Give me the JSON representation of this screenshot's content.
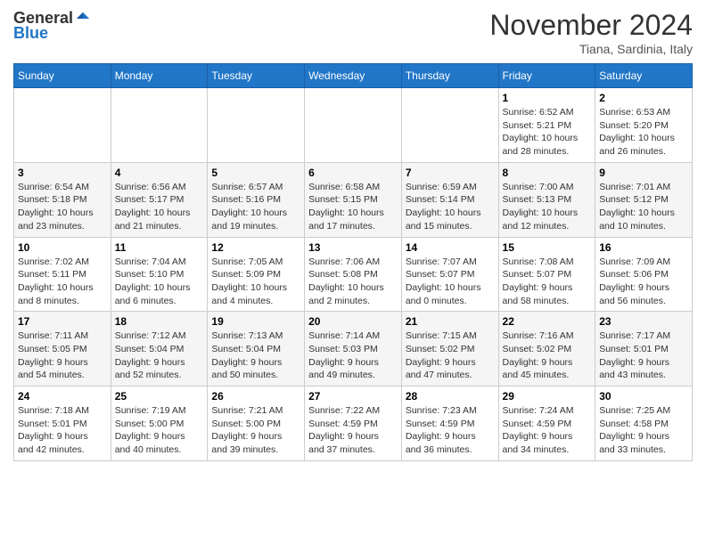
{
  "header": {
    "logo_general": "General",
    "logo_blue": "Blue",
    "month": "November 2024",
    "location": "Tiana, Sardinia, Italy"
  },
  "weekdays": [
    "Sunday",
    "Monday",
    "Tuesday",
    "Wednesday",
    "Thursday",
    "Friday",
    "Saturday"
  ],
  "weeks": [
    [
      {
        "day": "",
        "info": ""
      },
      {
        "day": "",
        "info": ""
      },
      {
        "day": "",
        "info": ""
      },
      {
        "day": "",
        "info": ""
      },
      {
        "day": "",
        "info": ""
      },
      {
        "day": "1",
        "info": "Sunrise: 6:52 AM\nSunset: 5:21 PM\nDaylight: 10 hours\nand 28 minutes."
      },
      {
        "day": "2",
        "info": "Sunrise: 6:53 AM\nSunset: 5:20 PM\nDaylight: 10 hours\nand 26 minutes."
      }
    ],
    [
      {
        "day": "3",
        "info": "Sunrise: 6:54 AM\nSunset: 5:18 PM\nDaylight: 10 hours\nand 23 minutes."
      },
      {
        "day": "4",
        "info": "Sunrise: 6:56 AM\nSunset: 5:17 PM\nDaylight: 10 hours\nand 21 minutes."
      },
      {
        "day": "5",
        "info": "Sunrise: 6:57 AM\nSunset: 5:16 PM\nDaylight: 10 hours\nand 19 minutes."
      },
      {
        "day": "6",
        "info": "Sunrise: 6:58 AM\nSunset: 5:15 PM\nDaylight: 10 hours\nand 17 minutes."
      },
      {
        "day": "7",
        "info": "Sunrise: 6:59 AM\nSunset: 5:14 PM\nDaylight: 10 hours\nand 15 minutes."
      },
      {
        "day": "8",
        "info": "Sunrise: 7:00 AM\nSunset: 5:13 PM\nDaylight: 10 hours\nand 12 minutes."
      },
      {
        "day": "9",
        "info": "Sunrise: 7:01 AM\nSunset: 5:12 PM\nDaylight: 10 hours\nand 10 minutes."
      }
    ],
    [
      {
        "day": "10",
        "info": "Sunrise: 7:02 AM\nSunset: 5:11 PM\nDaylight: 10 hours\nand 8 minutes."
      },
      {
        "day": "11",
        "info": "Sunrise: 7:04 AM\nSunset: 5:10 PM\nDaylight: 10 hours\nand 6 minutes."
      },
      {
        "day": "12",
        "info": "Sunrise: 7:05 AM\nSunset: 5:09 PM\nDaylight: 10 hours\nand 4 minutes."
      },
      {
        "day": "13",
        "info": "Sunrise: 7:06 AM\nSunset: 5:08 PM\nDaylight: 10 hours\nand 2 minutes."
      },
      {
        "day": "14",
        "info": "Sunrise: 7:07 AM\nSunset: 5:07 PM\nDaylight: 10 hours\nand 0 minutes."
      },
      {
        "day": "15",
        "info": "Sunrise: 7:08 AM\nSunset: 5:07 PM\nDaylight: 9 hours\nand 58 minutes."
      },
      {
        "day": "16",
        "info": "Sunrise: 7:09 AM\nSunset: 5:06 PM\nDaylight: 9 hours\nand 56 minutes."
      }
    ],
    [
      {
        "day": "17",
        "info": "Sunrise: 7:11 AM\nSunset: 5:05 PM\nDaylight: 9 hours\nand 54 minutes."
      },
      {
        "day": "18",
        "info": "Sunrise: 7:12 AM\nSunset: 5:04 PM\nDaylight: 9 hours\nand 52 minutes."
      },
      {
        "day": "19",
        "info": "Sunrise: 7:13 AM\nSunset: 5:04 PM\nDaylight: 9 hours\nand 50 minutes."
      },
      {
        "day": "20",
        "info": "Sunrise: 7:14 AM\nSunset: 5:03 PM\nDaylight: 9 hours\nand 49 minutes."
      },
      {
        "day": "21",
        "info": "Sunrise: 7:15 AM\nSunset: 5:02 PM\nDaylight: 9 hours\nand 47 minutes."
      },
      {
        "day": "22",
        "info": "Sunrise: 7:16 AM\nSunset: 5:02 PM\nDaylight: 9 hours\nand 45 minutes."
      },
      {
        "day": "23",
        "info": "Sunrise: 7:17 AM\nSunset: 5:01 PM\nDaylight: 9 hours\nand 43 minutes."
      }
    ],
    [
      {
        "day": "24",
        "info": "Sunrise: 7:18 AM\nSunset: 5:01 PM\nDaylight: 9 hours\nand 42 minutes."
      },
      {
        "day": "25",
        "info": "Sunrise: 7:19 AM\nSunset: 5:00 PM\nDaylight: 9 hours\nand 40 minutes."
      },
      {
        "day": "26",
        "info": "Sunrise: 7:21 AM\nSunset: 5:00 PM\nDaylight: 9 hours\nand 39 minutes."
      },
      {
        "day": "27",
        "info": "Sunrise: 7:22 AM\nSunset: 4:59 PM\nDaylight: 9 hours\nand 37 minutes."
      },
      {
        "day": "28",
        "info": "Sunrise: 7:23 AM\nSunset: 4:59 PM\nDaylight: 9 hours\nand 36 minutes."
      },
      {
        "day": "29",
        "info": "Sunrise: 7:24 AM\nSunset: 4:59 PM\nDaylight: 9 hours\nand 34 minutes."
      },
      {
        "day": "30",
        "info": "Sunrise: 7:25 AM\nSunset: 4:58 PM\nDaylight: 9 hours\nand 33 minutes."
      }
    ]
  ]
}
